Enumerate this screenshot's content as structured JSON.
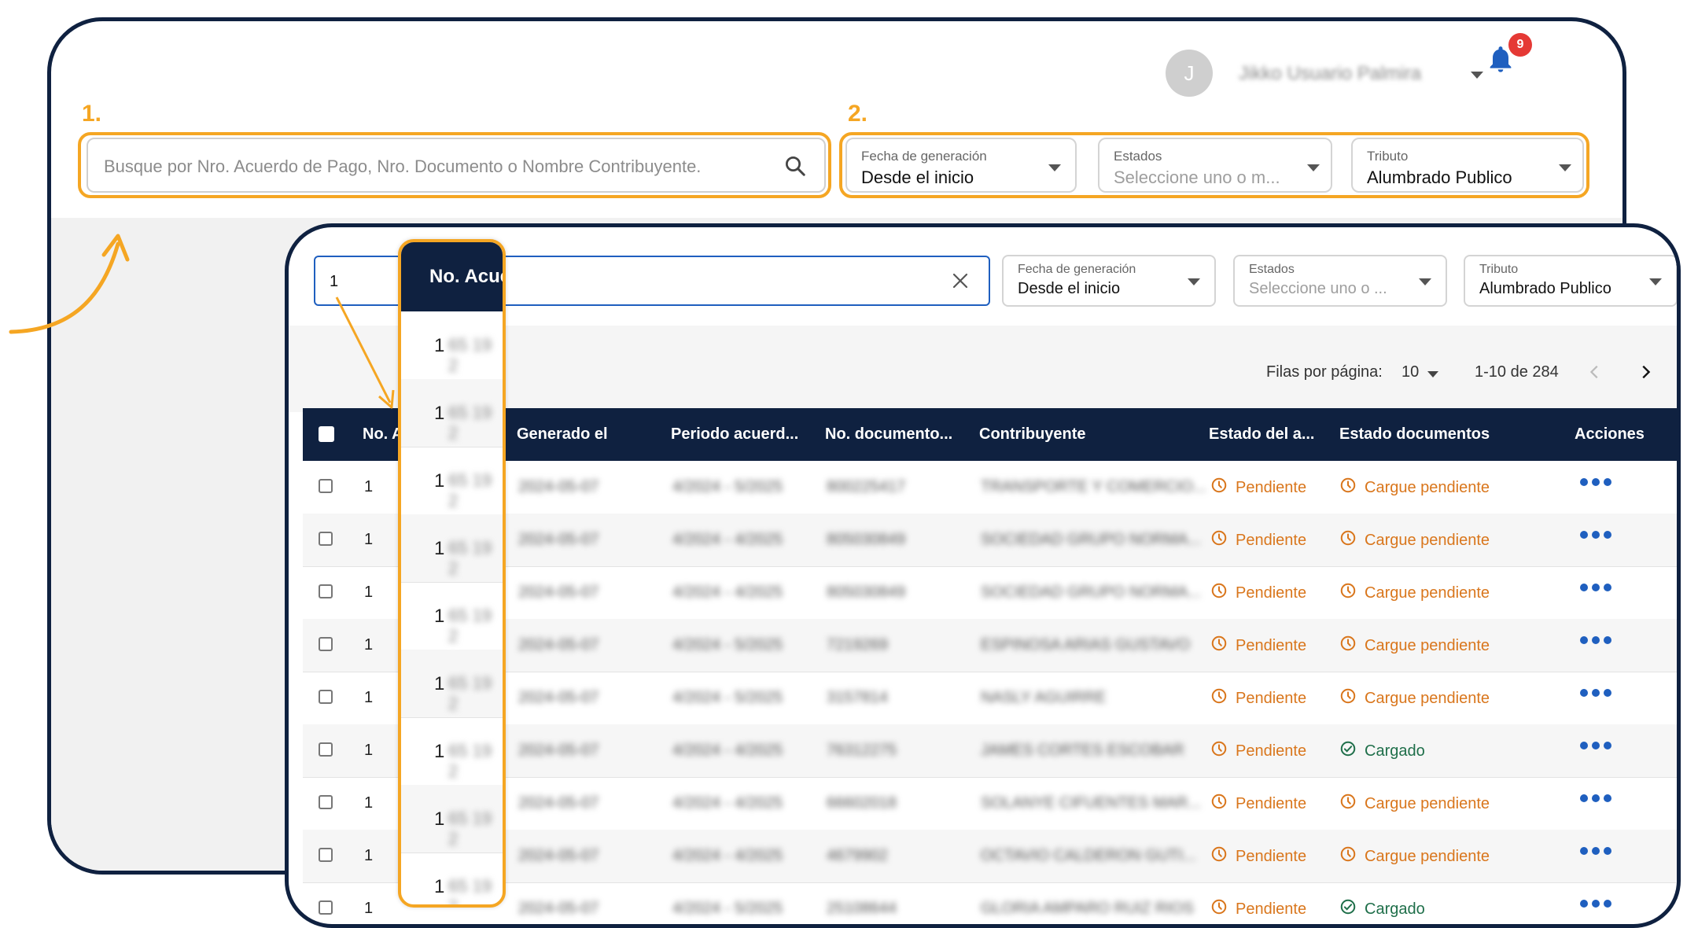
{
  "header": {
    "avatar_initial": "J",
    "user_name": "Jikko Usuario Palmira",
    "notification_count": "9"
  },
  "steps": {
    "one": "1.",
    "two": "2."
  },
  "search": {
    "placeholder": "Busque por Nro. Acuerdo de Pago, Nro. Documento o Nombre Contribuyente.",
    "typed_value": "1"
  },
  "filters": [
    {
      "label": "Fecha de generación",
      "value": "Desde el inicio",
      "placeholder": false
    },
    {
      "label": "Estados",
      "value": "Seleccione uno o m...",
      "placeholder": true
    },
    {
      "label": "Tributo",
      "value": "Alumbrado Publico",
      "placeholder": false
    }
  ],
  "filters_small": [
    {
      "label": "Fecha de generación",
      "value": "Desde el inicio",
      "placeholder": false
    },
    {
      "label": "Estados",
      "value": "Seleccione uno o ...",
      "placeholder": true
    },
    {
      "label": "Tributo",
      "value": "Alumbrado Publico",
      "placeholder": false
    }
  ],
  "pagination": {
    "rows_label": "Filas por página:",
    "rows_value": "10",
    "range": "1-10 de 284"
  },
  "table": {
    "headers": [
      "No. A",
      "Generado el",
      "Periodo acuerd...",
      "No. documento...",
      "Contribuyente",
      "Estado del a...",
      "Estado documentos",
      "Acciones"
    ],
    "rows": [
      {
        "no": "1",
        "generated": "2024-05-07",
        "period": "4/2024 - 5/2025",
        "doc": "800225417",
        "taxpayer": "TRANSPORTE Y COMERCIO...",
        "state": "Pendiente",
        "docs_state": "Cargue pendiente",
        "docs_ok": false
      },
      {
        "no": "1",
        "generated": "2024-05-07",
        "period": "4/2024 - 4/2025",
        "doc": "805030849",
        "taxpayer": "SOCIEDAD GRUPO NORMA...",
        "state": "Pendiente",
        "docs_state": "Cargue pendiente",
        "docs_ok": false
      },
      {
        "no": "1",
        "generated": "2024-05-07",
        "period": "4/2024 - 4/2025",
        "doc": "805030849",
        "taxpayer": "SOCIEDAD GRUPO NORMA...",
        "state": "Pendiente",
        "docs_state": "Cargue pendiente",
        "docs_ok": false
      },
      {
        "no": "1",
        "generated": "2024-05-07",
        "period": "4/2024 - 5/2025",
        "doc": "7219269",
        "taxpayer": "ESPINOSA ARIAS GUSTAVO",
        "state": "Pendiente",
        "docs_state": "Cargue pendiente",
        "docs_ok": false
      },
      {
        "no": "1",
        "generated": "2024-05-07",
        "period": "4/2024 - 5/2025",
        "doc": "3157814",
        "taxpayer": "NASLY AGUIRRE",
        "state": "Pendiente",
        "docs_state": "Cargue pendiente",
        "docs_ok": false
      },
      {
        "no": "1",
        "generated": "2024-05-07",
        "period": "4/2024 - 4/2025",
        "doc": "76312275",
        "taxpayer": "JAMES CORTES ESCOBAR",
        "state": "Pendiente",
        "docs_state": "Cargado",
        "docs_ok": true
      },
      {
        "no": "1",
        "generated": "2024-05-07",
        "period": "4/2024 - 4/2025",
        "doc": "66602018",
        "taxpayer": "SOLANYE CIFUENTES MAR...",
        "state": "Pendiente",
        "docs_state": "Cargue pendiente",
        "docs_ok": false
      },
      {
        "no": "1",
        "generated": "2024-05-07",
        "period": "4/2024 - 4/2025",
        "doc": "4679902",
        "taxpayer": "OCTAVIO CALDERON GUTI...",
        "state": "Pendiente",
        "docs_state": "Cargue pendiente",
        "docs_ok": false
      },
      {
        "no": "1",
        "generated": "2024-05-07",
        "period": "4/2024 - 5/2025",
        "doc": "25108644",
        "taxpayer": "GLORIA AMPARO RUIZ RIOS",
        "state": "Pendiente",
        "docs_state": "Cargado",
        "docs_ok": true
      }
    ]
  },
  "highlight": {
    "header": "No. Acue",
    "values": [
      "1",
      "1",
      "1",
      "1",
      "1",
      "1",
      "1",
      "1",
      "1"
    ],
    "blurred": "65 19 2"
  },
  "colors": {
    "navy": "#0f2140",
    "orange": "#f5a623",
    "pending": "#d9761c",
    "ok": "#1f6f4a",
    "blue": "#1f5fbf"
  }
}
